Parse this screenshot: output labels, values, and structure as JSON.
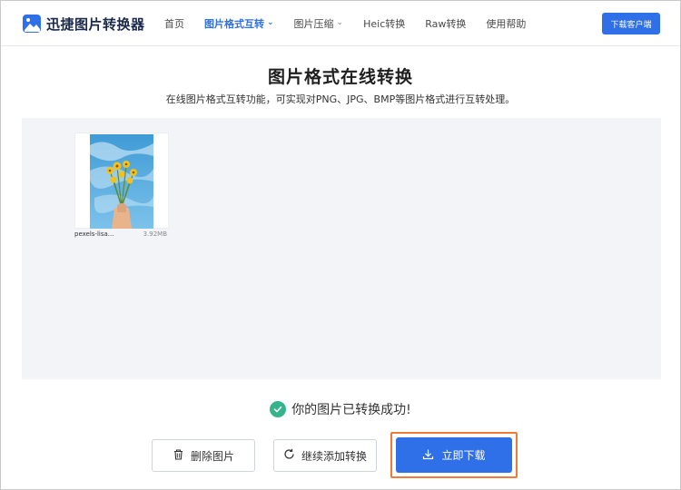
{
  "header": {
    "app_name": "迅捷图片转换器",
    "nav": [
      {
        "label": "首页",
        "has_dropdown": false,
        "active": false
      },
      {
        "label": "图片格式互转",
        "has_dropdown": true,
        "active": true
      },
      {
        "label": "图片压缩",
        "has_dropdown": true,
        "active": false
      },
      {
        "label": "Heic转换",
        "has_dropdown": false,
        "active": false
      },
      {
        "label": "Raw转换",
        "has_dropdown": false,
        "active": false
      },
      {
        "label": "使用帮助",
        "has_dropdown": false,
        "active": false
      }
    ],
    "download_client_label": "下载客户端"
  },
  "main": {
    "title": "图片格式在线转换",
    "subtitle": "在线图片格式互转功能，可实现对PNG、JPG、BMP等图片格式进行互转处理。",
    "files": [
      {
        "name": "pexels-lisa...",
        "size": "3.92MB"
      }
    ],
    "success_message": "你的图片已转换成功!",
    "buttons": {
      "delete": "删除图片",
      "add_more": "继续添加转换",
      "download": "立即下载"
    }
  },
  "colors": {
    "accent": "#2f6fe8",
    "success": "#36b38a",
    "highlight_border": "#f07a3a",
    "dropzone_bg": "#f2f4f8"
  },
  "icons": [
    "image-logo-icon",
    "chevron-down-icon",
    "check-circle-icon",
    "trash-icon",
    "refresh-icon",
    "download-icon"
  ]
}
